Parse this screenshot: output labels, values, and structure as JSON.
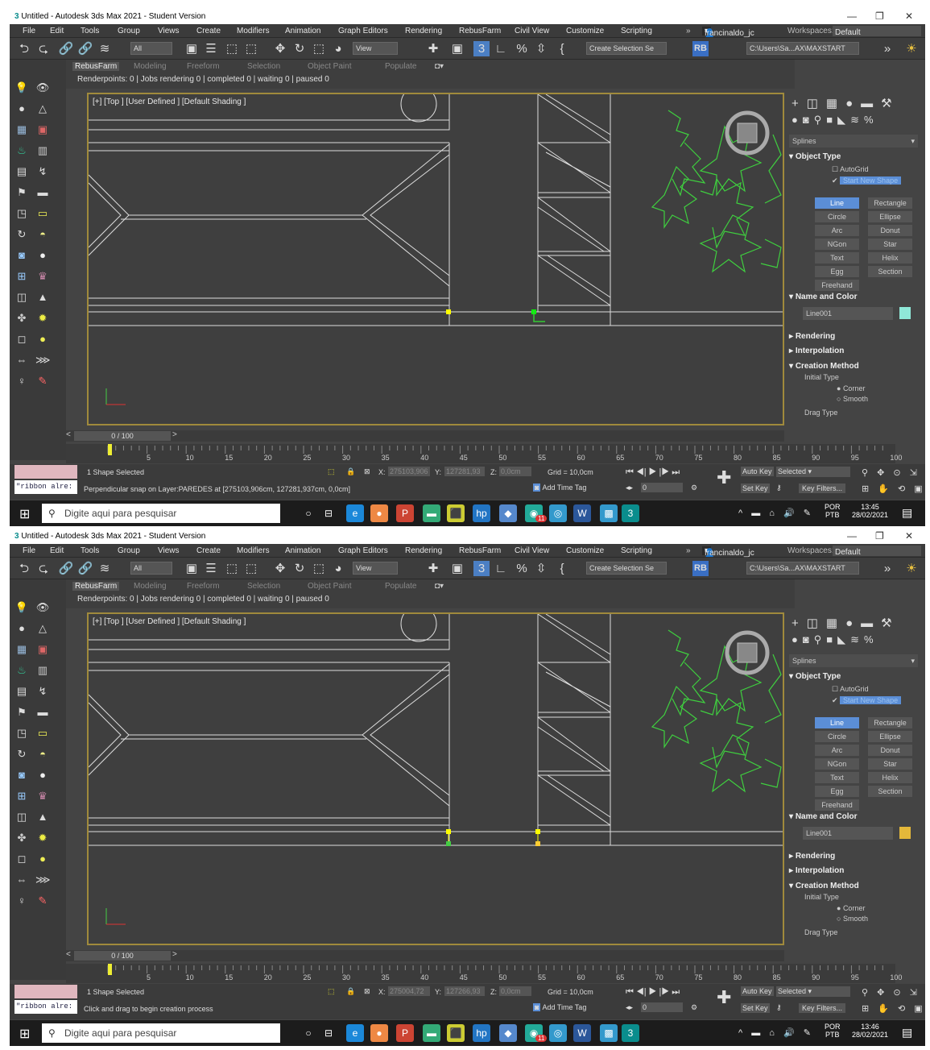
{
  "window": {
    "title": "Untitled - Autodesk 3ds Max 2021 - Student Version",
    "controls": [
      "—",
      "❐",
      "✕"
    ]
  },
  "menu": [
    "File",
    "Edit",
    "Tools",
    "Group",
    "Views",
    "Create",
    "Modifiers",
    "Animation",
    "Graph Editors",
    "Rendering",
    "RebusFarm",
    "Civil View",
    "Customize",
    "Scripting"
  ],
  "user": "francinaldo_jc",
  "workspace": {
    "label": "Workspaces:",
    "value": "Default"
  },
  "toolbar": {
    "filter_value": "All",
    "ref_coord": "View",
    "named_selection": "Create Selection Se",
    "project_path": "C:\\Users\\Sa...AX\\MAXSTART"
  },
  "ribbon": {
    "tabs": [
      "RebusFarm",
      "Modeling",
      "Freeform",
      "Selection",
      "Object Paint",
      "Populate"
    ],
    "info": "Renderpoints: 0 | Jobs rendering 0 | completed 0 | waiting 0 | paused 0"
  },
  "viewport": {
    "label": "[+] [Top ] [User Defined ] [Default Shading ]"
  },
  "command_panel": {
    "category": "Splines",
    "object_type_title": "Object Type",
    "autogrid": "AutoGrid",
    "start_new_shape": "Start New Shape",
    "buttons": [
      "Line",
      "Rectangle",
      "Circle",
      "Ellipse",
      "Arc",
      "Donut",
      "NGon",
      "Star",
      "Text",
      "Helix",
      "Egg",
      "Section",
      "Freehand"
    ],
    "name_color_title": "Name and Color",
    "object_name": "Line001",
    "rollouts": [
      "Rendering",
      "Interpolation",
      "Creation Method"
    ],
    "initial_type": "Initial Type",
    "corner": "Corner",
    "smooth": "Smooth",
    "drag_type": "Drag Type"
  },
  "time_slider": "0 / 100",
  "trackbar_ticks": [
    "5",
    "10",
    "15",
    "20",
    "25",
    "30",
    "35",
    "40",
    "45",
    "50",
    "55",
    "60",
    "65",
    "70",
    "75",
    "80",
    "85",
    "90",
    "95",
    "100"
  ],
  "grid": "Grid = 10,0cm",
  "add_time_tag": "Add Time Tag",
  "auto_key": "Auto Key",
  "set_key": "Set Key",
  "key_filters": "Key Filters...",
  "selected_dropdown": "Selected",
  "frame_value": "0",
  "shape_selected": "1 Shape Selected",
  "maxscript": "\"ribbon alre:",
  "search_placeholder": "Digite aqui para pesquisar",
  "lang": {
    "top": "POR",
    "bottom": "PTB"
  },
  "date": "28/02/2021",
  "notification_count": "11",
  "screens": [
    {
      "x": "275103,906",
      "y": "127281,93",
      "z": "0,0cm",
      "prompt": "Perpendicular snap on Layer:PAREDES at [275103,906cm, 127281,937cm, 0,0cm]",
      "time": "13:45",
      "swatch_color": "#8fe8d8"
    },
    {
      "x": "275004,72",
      "y": "127266,93",
      "z": "0,0cm",
      "prompt": "Click and drag to begin creation process",
      "time": "13:46",
      "swatch_color": "#e4b83a"
    }
  ]
}
